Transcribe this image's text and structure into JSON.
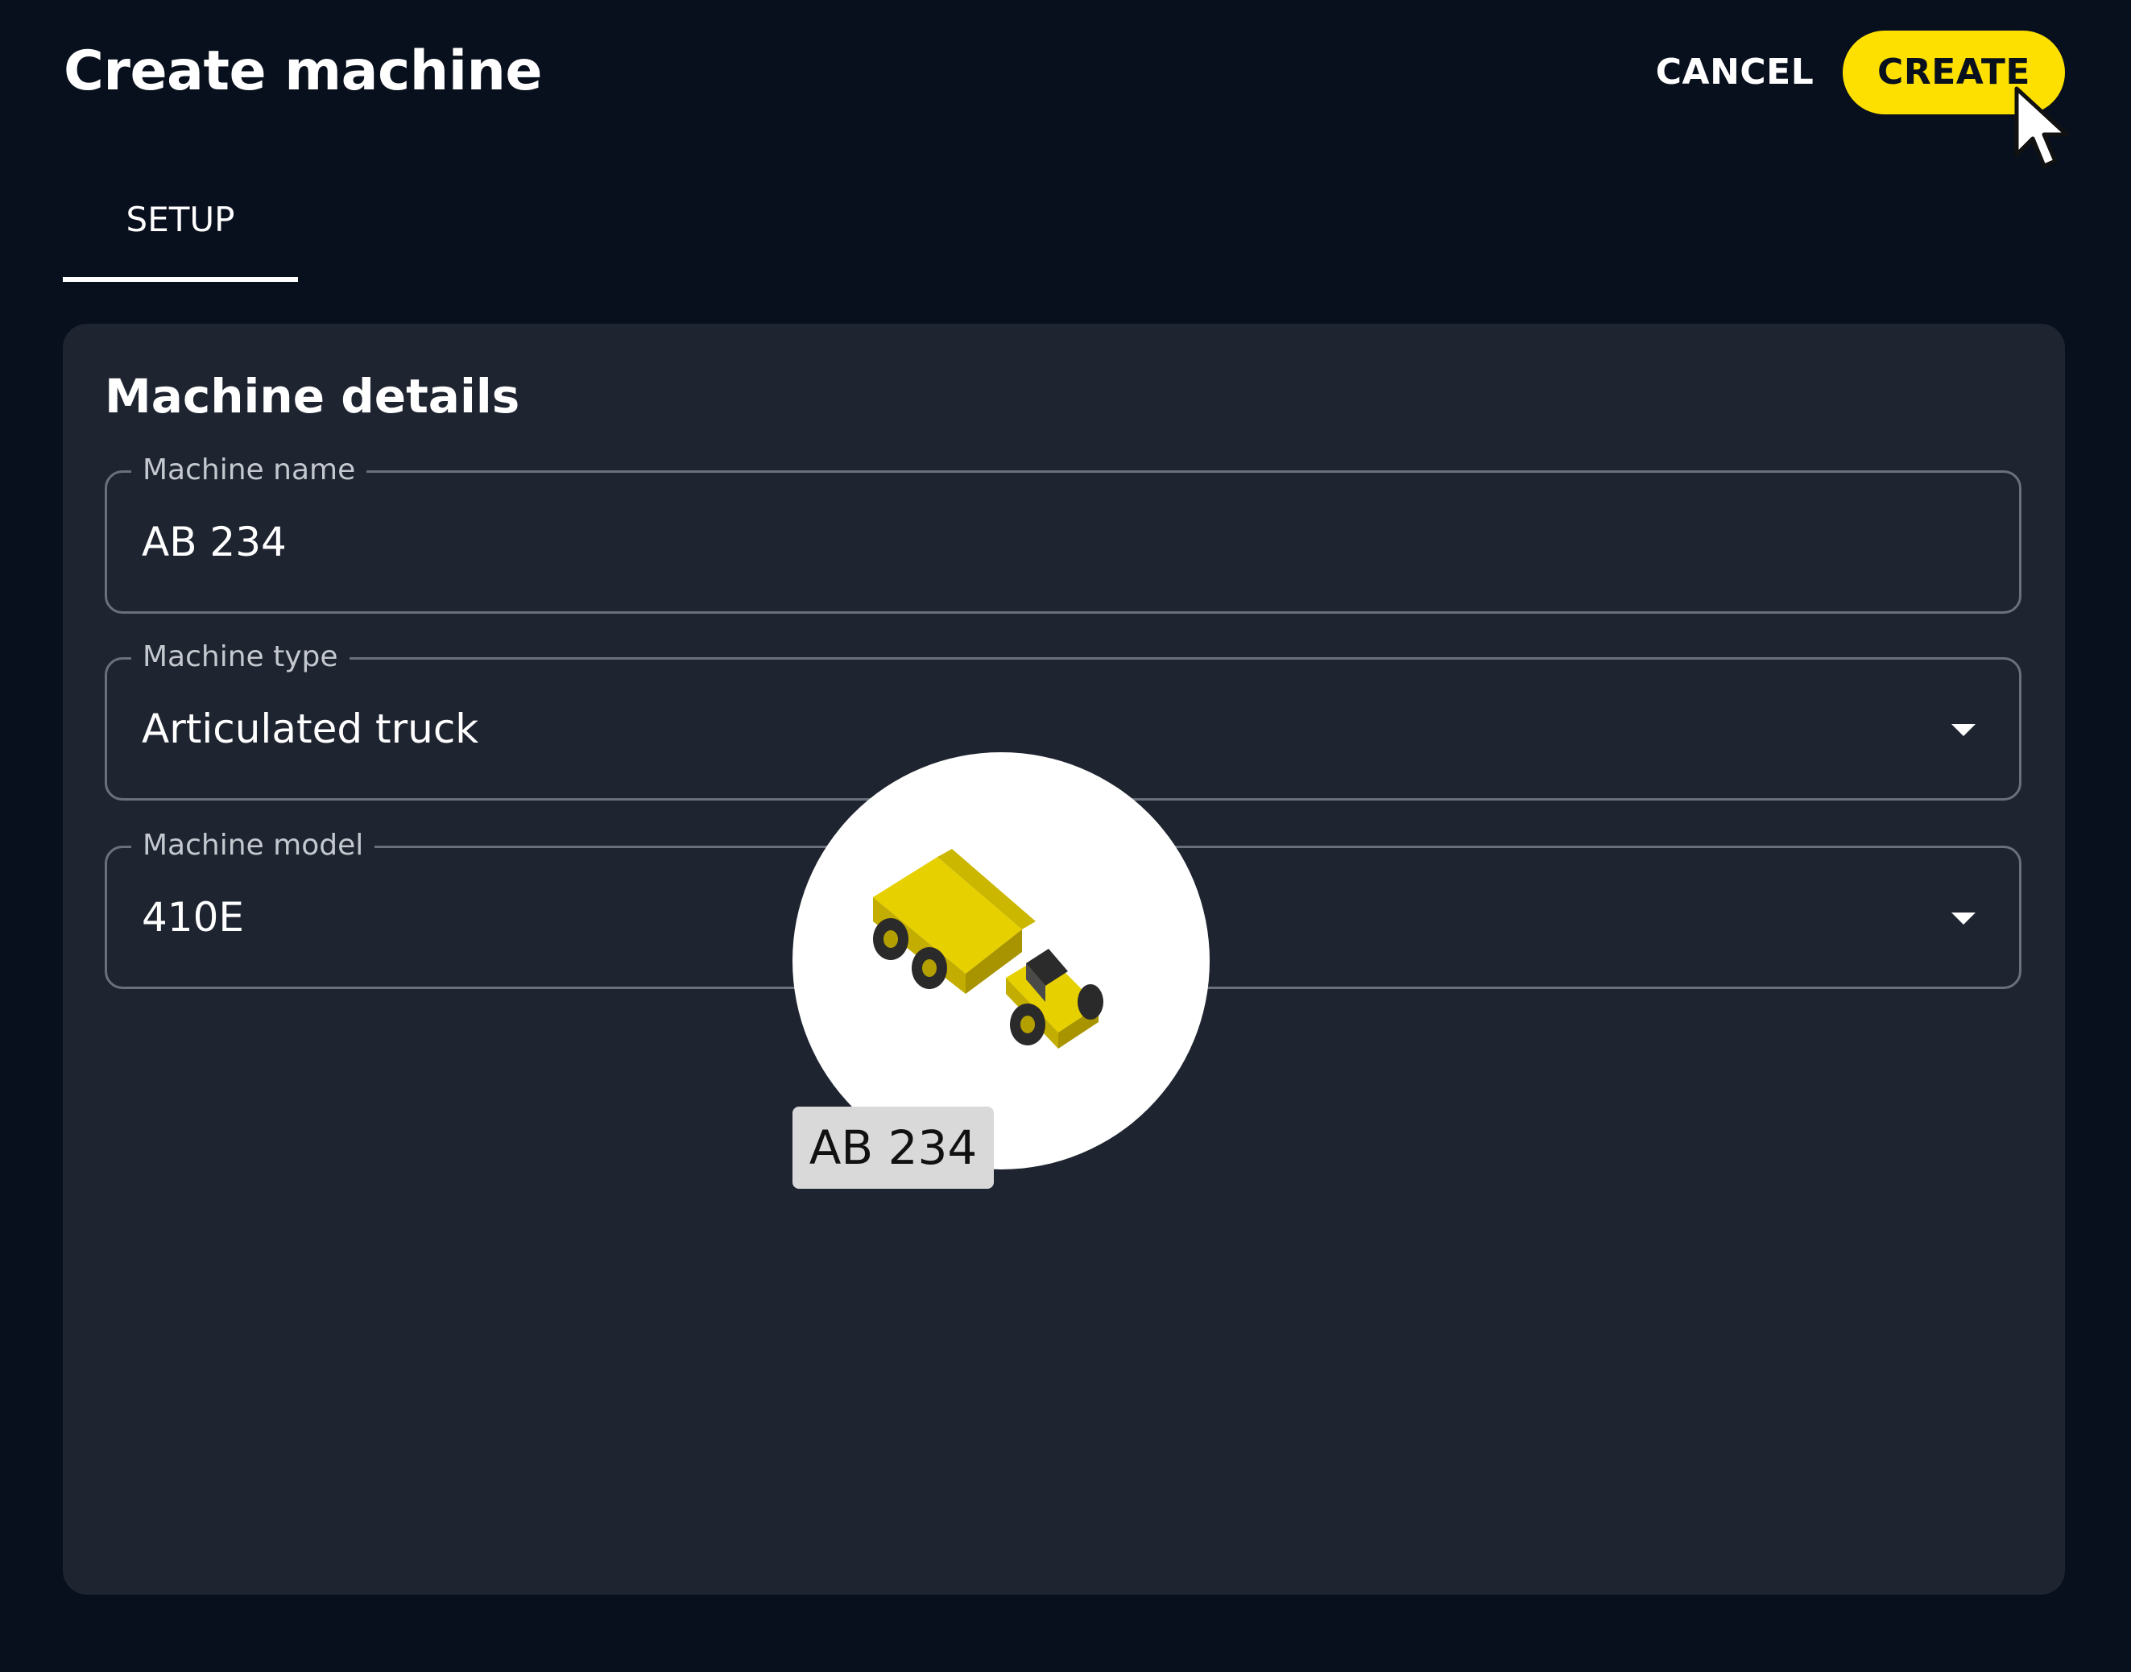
{
  "header": {
    "title": "Create machine",
    "cancel_label": "CANCEL",
    "create_label": "CREATE"
  },
  "tabs": [
    {
      "label": "SETUP",
      "active": true
    }
  ],
  "form": {
    "title": "Machine details",
    "machine_name": {
      "label": "Machine name",
      "value": "AB 234"
    },
    "machine_type": {
      "label": "Machine type",
      "value": "Articulated truck"
    },
    "machine_model": {
      "label": "Machine model",
      "value": "410E"
    }
  },
  "preview": {
    "icon": "articulated-truck-icon",
    "label": "AB 234"
  },
  "colors": {
    "background": "#09101d",
    "card": "#1e2430",
    "accent": "#fee000",
    "field_border": "#6a717d"
  }
}
